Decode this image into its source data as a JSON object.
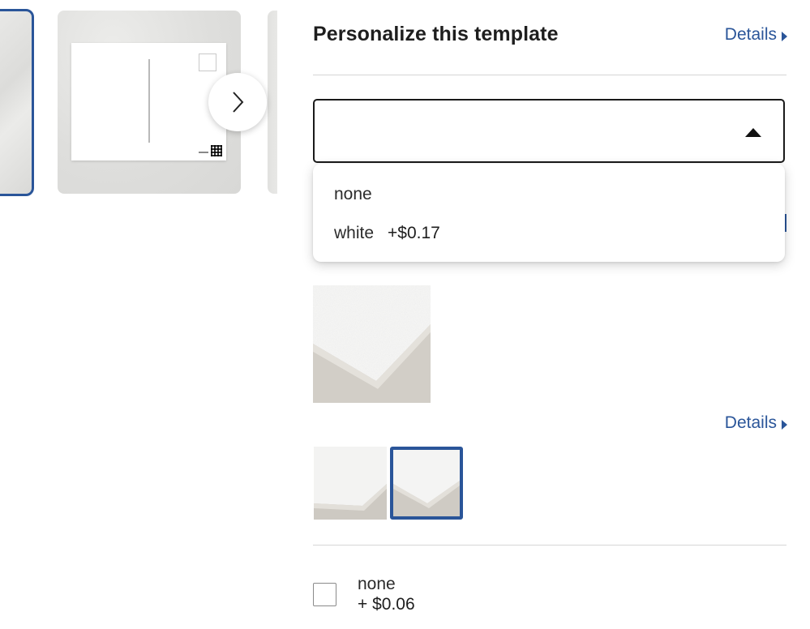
{
  "panel": {
    "title": "Personalize this template",
    "details_label": "Details",
    "details_label_2": "Details"
  },
  "carousel": {
    "next_icon": "chevron-right-icon"
  },
  "dropdown": {
    "selected_value": "",
    "options": [
      {
        "label": "none",
        "price": ""
      },
      {
        "label": "white",
        "price": "+$0.17"
      }
    ]
  },
  "paper_options": {
    "selected_index": 1
  },
  "addon": {
    "label": "none",
    "price": "+ $0.06",
    "checked": false
  },
  "colors": {
    "accent": "#2a5599",
    "text": "#1e1e1e",
    "divider": "#d6d6d6"
  }
}
